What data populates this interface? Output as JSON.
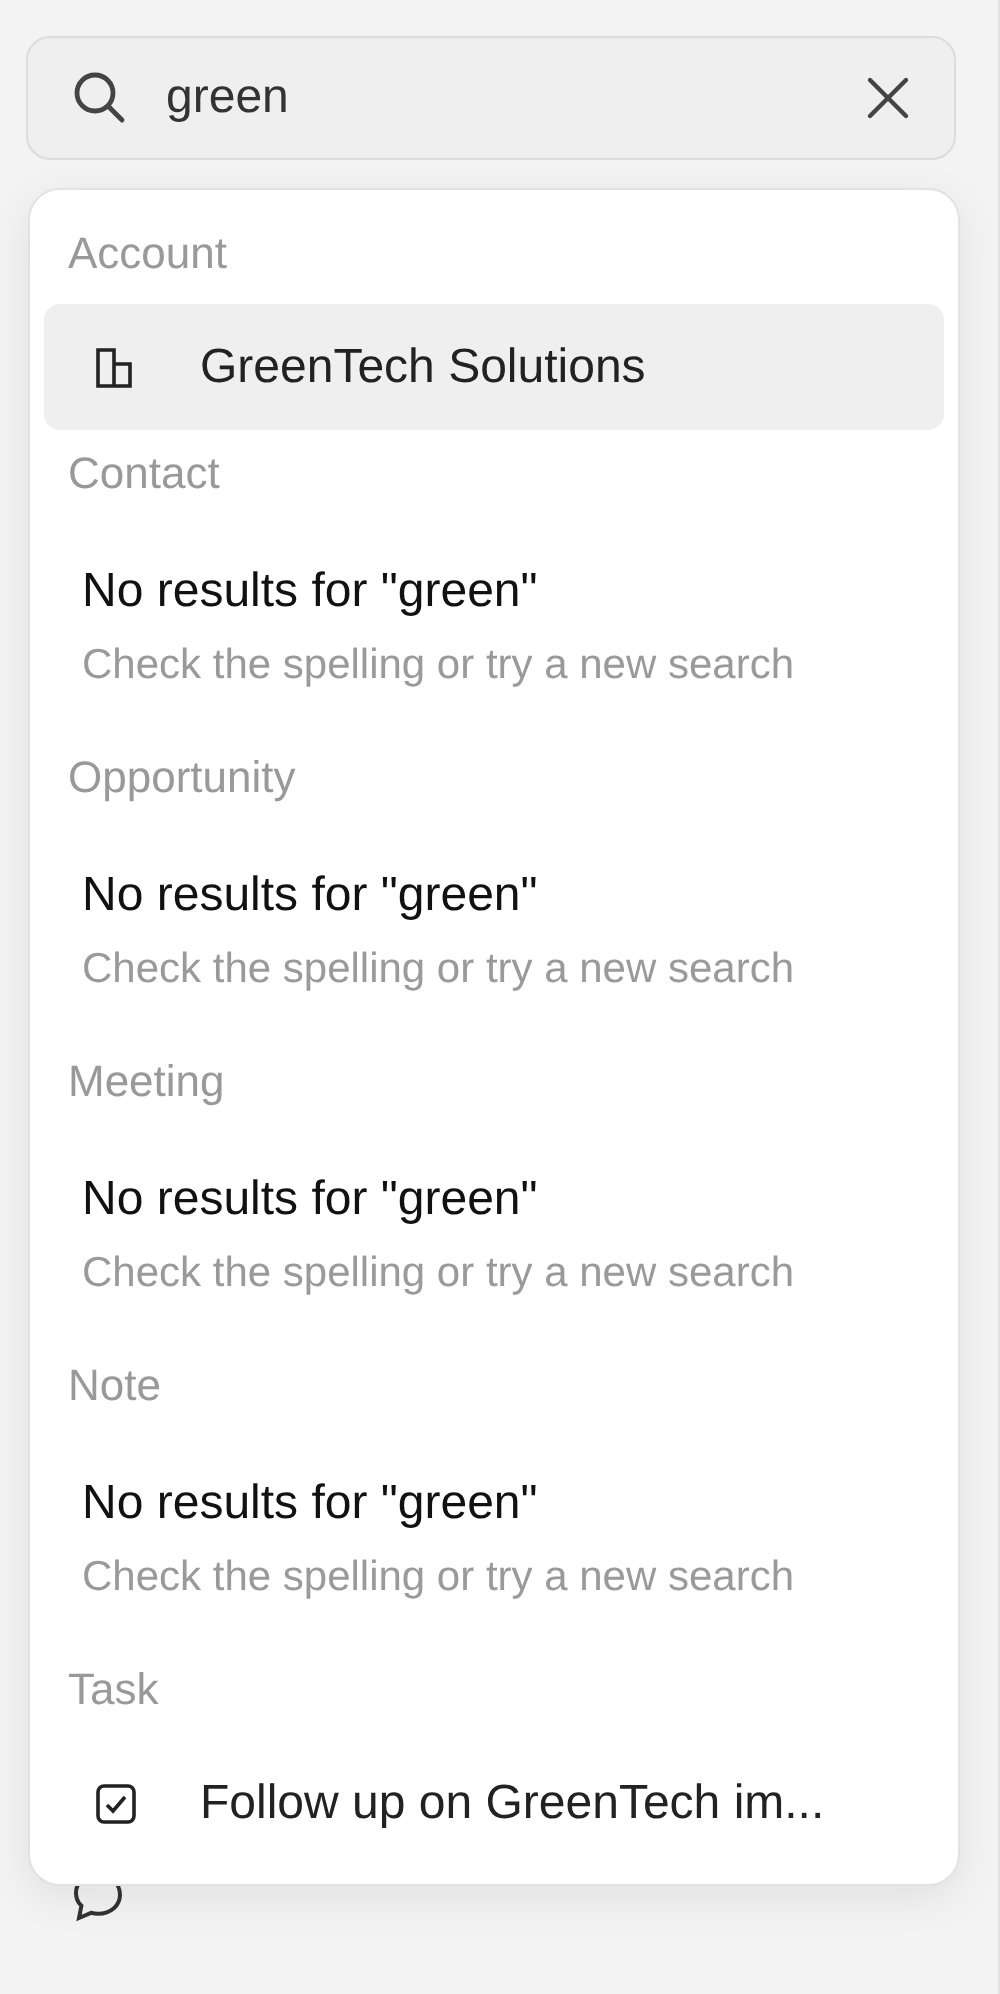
{
  "search": {
    "value": "green"
  },
  "sections": [
    {
      "title": "Account",
      "kind": "results",
      "items": [
        {
          "label": "GreenTech Solutions",
          "kind": "account",
          "selected": true
        }
      ]
    },
    {
      "title": "Contact",
      "kind": "empty",
      "message": "No results for \"green\"",
      "hint": "Check the spelling or try a new search"
    },
    {
      "title": "Opportunity",
      "kind": "empty",
      "message": "No results for \"green\"",
      "hint": "Check the spelling or try a new search"
    },
    {
      "title": "Meeting",
      "kind": "empty",
      "message": "No results for \"green\"",
      "hint": "Check the spelling or try a new search"
    },
    {
      "title": "Note",
      "kind": "empty",
      "message": "No results for \"green\"",
      "hint": "Check the spelling or try a new search"
    },
    {
      "title": "Task",
      "kind": "results",
      "items": [
        {
          "label": "Follow up on GreenTech im...",
          "kind": "task",
          "selected": false
        }
      ]
    }
  ]
}
